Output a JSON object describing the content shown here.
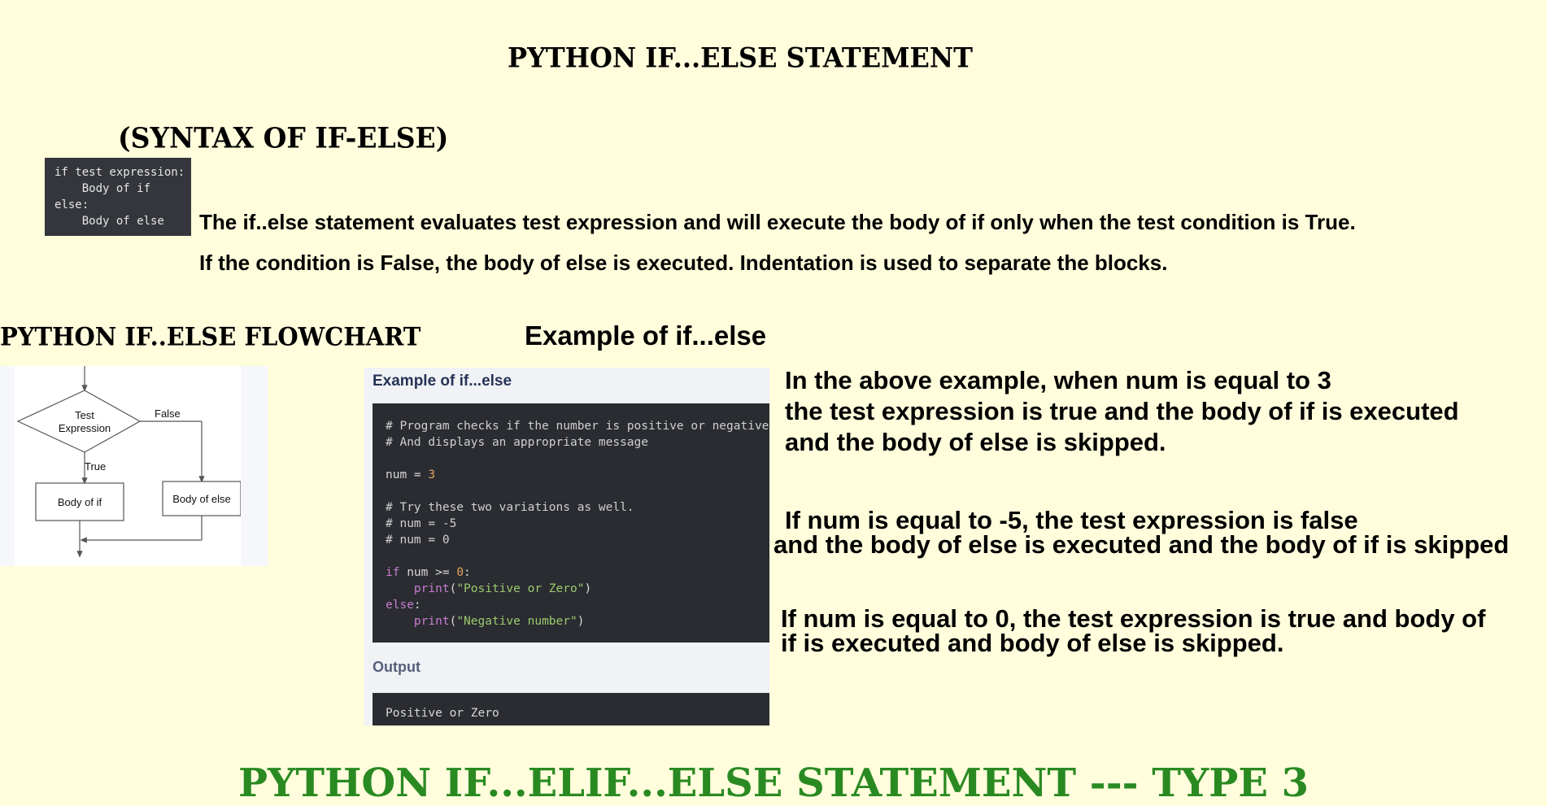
{
  "page_title": "PYTHON IF...ELSE STATEMENT",
  "syntax_title": "(SYNTAX OF IF-ELSE)",
  "syntax_code": "if test expression:\n    Body of if\nelse:\n    Body of else",
  "description": {
    "line1": "The if..else statement evaluates test expression and will execute the body of if only when the test condition is True.",
    "line2": "If the condition is False, the body of else is executed. Indentation is used to separate the blocks."
  },
  "flowchart_title": "PYTHON IF..ELSE FLOWCHART",
  "flowchart": {
    "decision": [
      "Test",
      "Expression"
    ],
    "false_label": "False",
    "true_label": "True",
    "body_if": "Body of if",
    "body_else": "Body of else"
  },
  "example_heading": "Example of if...else",
  "example_panel": {
    "title": "Example of if...else",
    "code": {
      "c1": "# Program checks if the number is positive or negative",
      "c2": "# And displays an appropriate message",
      "num_var": "num = ",
      "num_val": "3",
      "c3": "# Try these two variations as well.",
      "c4": "# num = -5",
      "c5": "# num = 0",
      "if_kw": "if",
      "if_rest": " num >= ",
      "if_zero": "0",
      "if_colon": ":",
      "print1_fn": "print",
      "print1_str": "\"Positive or Zero\"",
      "else_kw": "else",
      "else_colon": ":",
      "print2_fn": "print",
      "print2_str": "\"Negative number\""
    },
    "output_label": "Output",
    "output_text": "Positive or Zero"
  },
  "explanation": {
    "p1": [
      "In the above example, when num is equal to 3",
      "the test expression is true and the body of if is executed",
      "and the body of else is skipped."
    ],
    "p2": [
      "If num is equal to -5, the test expression is false",
      "and the body of else is executed and the body of if is skipped"
    ],
    "p3": [
      "If num is equal to 0, the test expression is true and body of",
      "if is executed and body of else is skipped."
    ]
  },
  "bottom_title": "PYTHON IF...ELIF...ELSE STATEMENT --- TYPE 3",
  "colors": {
    "background": "#fffddc",
    "bottom_title": "#2a8a22",
    "code_bg": "#2a2c31",
    "panel_title": "#253356"
  }
}
